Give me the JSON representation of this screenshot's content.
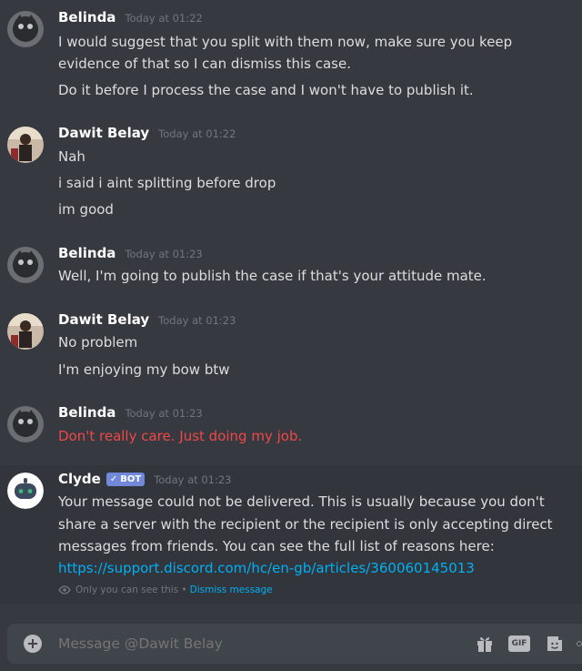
{
  "messages": [
    {
      "author": "Belinda",
      "timestamp": "Today at 01:22",
      "lines": [
        "I would suggest that you split with them now, make sure you keep",
        "evidence of that so I can dismiss this case.",
        "Do it before I process the case and I won't have to publish it."
      ]
    },
    {
      "author": "Dawit Belay",
      "timestamp": "Today at 01:22",
      "lines": [
        "Nah",
        "i said i aint splitting before drop",
        "im good"
      ]
    },
    {
      "author": "Belinda",
      "timestamp": "Today at 01:23",
      "lines": [
        "Well, I'm going to publish the case if that's your attitude mate."
      ]
    },
    {
      "author": "Dawit Belay",
      "timestamp": "Today at 01:23",
      "lines": [
        "No problem",
        "I'm enjoying my bow btw"
      ]
    },
    {
      "author": "Belinda",
      "timestamp": "Today at 01:23",
      "lines": [
        "Don't really care. Just doing my job."
      ],
      "failed_color": "#f04747"
    },
    {
      "author": "Clyde",
      "bot_tag": "BOT",
      "timestamp": "Today at 01:23",
      "lines": [
        "Your message could not be delivered. This is usually because you don't",
        "share a server with the recipient or the recipient is only accepting direct",
        "messages from friends. You can see the full list of reasons here:"
      ],
      "link": "https://support.discord.com/hc/en-gb/articles/360060145013",
      "ephemeral_note": "Only you can see this •",
      "dismiss_label": "Dismiss message"
    }
  ],
  "composer": {
    "placeholder": "Message @Dawit Belay",
    "icons": [
      "plus-icon",
      "gift-icon",
      "gif-icon",
      "sticker-icon",
      "emoji-icon"
    ],
    "gif_label": "GIF"
  },
  "colors": {
    "background": "#36393f",
    "link": "#00b0f4",
    "bot_tag": "#7289da",
    "error_text": "#f04747"
  }
}
